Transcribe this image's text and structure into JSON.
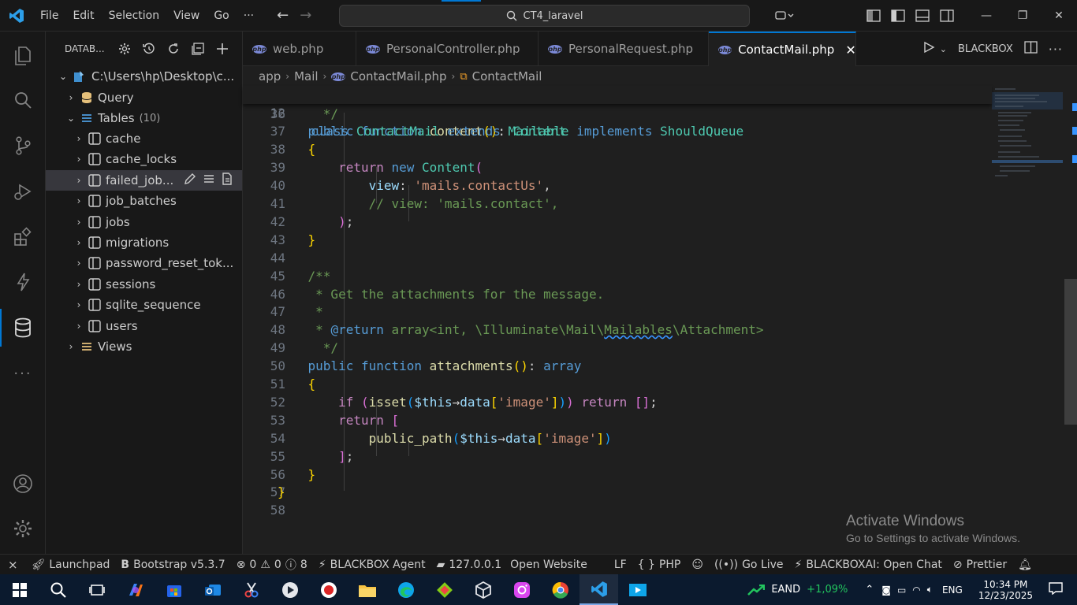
{
  "titlebar": {
    "menu": [
      "File",
      "Edit",
      "Selection",
      "View",
      "Go"
    ],
    "more": "···",
    "search_text": "CT4_laravel"
  },
  "sidebar": {
    "title": "DATAB...",
    "connection": "C:\\Users\\hp\\Desktop\\c...",
    "query_label": "Query",
    "tables_label": "Tables",
    "tables_count": "(10)",
    "tables": [
      "cache",
      "cache_locks",
      "failed_job...",
      "job_batches",
      "jobs",
      "migrations",
      "password_reset_tok...",
      "sessions",
      "sqlite_sequence",
      "users"
    ],
    "views_label": "Views"
  },
  "tabs": [
    {
      "label": "web.php"
    },
    {
      "label": "PersonalController.php"
    },
    {
      "label": "PersonalRequest.php"
    },
    {
      "label": "ContactMail.php"
    }
  ],
  "tabs_right": {
    "blackbox": "BLACKBOX"
  },
  "breadcrumb": [
    "app",
    "Mail",
    "ContactMail.php",
    "ContactMail"
  ],
  "editor": {
    "sticky_line": {
      "n": "12",
      "text": "class ContactMail extends Mailable implements ShouldQueue"
    },
    "line_numbers": [
      "36",
      "37",
      "38",
      "39",
      "40",
      "41",
      "42",
      "43",
      "44",
      "45",
      "46",
      "47",
      "48",
      "49",
      "50",
      "51",
      "52",
      "53",
      "54",
      "55",
      "56",
      "57",
      "58"
    ]
  },
  "watermark": {
    "line1": "Activate Windows",
    "line2": "Go to Settings to activate Windows."
  },
  "statusbar": {
    "launchpad": "Launchpad",
    "bootstrap": "Bootstrap v5.3.7",
    "errors": "0",
    "warnings": "0",
    "infos": "8",
    "blackbox_agent": "BLACKBOX Agent",
    "server": "127.0.0.1",
    "open_website": "Open Website",
    "eol": "LF",
    "language": "PHP",
    "go_live": "Go Live",
    "blackboxai": "BLACKBOXAI: Open Chat",
    "prettier": "Prettier"
  },
  "taskbar": {
    "stock_name": "EAND",
    "stock_change": "+1,09%",
    "lang": "ENG",
    "time": "10:34 PM",
    "date": "12/23/2025"
  },
  "colors": {
    "accent": "#0078d4",
    "keyword": "#569cd6",
    "type": "#4ec9b0",
    "function": "#dcdcaa",
    "string": "#ce9178",
    "comment": "#6a9955"
  }
}
